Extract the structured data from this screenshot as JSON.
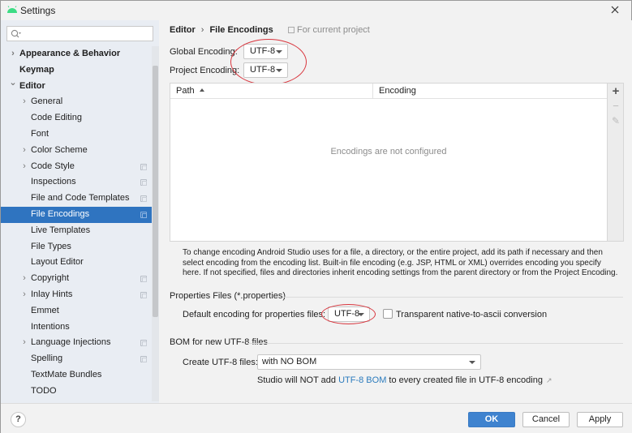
{
  "window": {
    "title": "Settings",
    "close_icon": "close-icon",
    "logo_icon": "android-icon"
  },
  "sidebar": {
    "search": {
      "value": "",
      "placeholder": "",
      "icon": "search-icon"
    },
    "items": [
      {
        "label": "Appearance & Behavior",
        "level": 0,
        "bold": true,
        "chevron": "right",
        "project_icon": false
      },
      {
        "label": "Keymap",
        "level": 0,
        "bold": true,
        "chevron": "none",
        "project_icon": false
      },
      {
        "label": "Editor",
        "level": 0,
        "bold": true,
        "chevron": "down",
        "project_icon": false
      },
      {
        "label": "General",
        "level": 1,
        "bold": false,
        "chevron": "right",
        "project_icon": false
      },
      {
        "label": "Code Editing",
        "level": 1,
        "bold": false,
        "chevron": "none",
        "project_icon": false
      },
      {
        "label": "Font",
        "level": 1,
        "bold": false,
        "chevron": "none",
        "project_icon": false
      },
      {
        "label": "Color Scheme",
        "level": 1,
        "bold": false,
        "chevron": "right",
        "project_icon": false
      },
      {
        "label": "Code Style",
        "level": 1,
        "bold": false,
        "chevron": "right",
        "project_icon": true
      },
      {
        "label": "Inspections",
        "level": 1,
        "bold": false,
        "chevron": "none",
        "project_icon": true
      },
      {
        "label": "File and Code Templates",
        "level": 1,
        "bold": false,
        "chevron": "none",
        "project_icon": true
      },
      {
        "label": "File Encodings",
        "level": 1,
        "bold": false,
        "chevron": "none",
        "project_icon": true,
        "selected": true
      },
      {
        "label": "Live Templates",
        "level": 1,
        "bold": false,
        "chevron": "none",
        "project_icon": false
      },
      {
        "label": "File Types",
        "level": 1,
        "bold": false,
        "chevron": "none",
        "project_icon": false
      },
      {
        "label": "Layout Editor",
        "level": 1,
        "bold": false,
        "chevron": "none",
        "project_icon": false
      },
      {
        "label": "Copyright",
        "level": 1,
        "bold": false,
        "chevron": "right",
        "project_icon": true
      },
      {
        "label": "Inlay Hints",
        "level": 1,
        "bold": false,
        "chevron": "right",
        "project_icon": true
      },
      {
        "label": "Emmet",
        "level": 1,
        "bold": false,
        "chevron": "none",
        "project_icon": false
      },
      {
        "label": "Intentions",
        "level": 1,
        "bold": false,
        "chevron": "none",
        "project_icon": false
      },
      {
        "label": "Language Injections",
        "level": 1,
        "bold": false,
        "chevron": "right",
        "project_icon": true
      },
      {
        "label": "Spelling",
        "level": 1,
        "bold": false,
        "chevron": "none",
        "project_icon": true
      },
      {
        "label": "TextMate Bundles",
        "level": 1,
        "bold": false,
        "chevron": "none",
        "project_icon": false
      },
      {
        "label": "TODO",
        "level": 1,
        "bold": false,
        "chevron": "none",
        "project_icon": false
      }
    ]
  },
  "main": {
    "breadcrumb": {
      "parent": "Editor",
      "separator": "›",
      "current": "File Encodings"
    },
    "scope_note": "For current project",
    "global_encoding": {
      "label": "Global Encoding:",
      "value": "UTF-8"
    },
    "project_encoding": {
      "label": "Project Encoding:",
      "value": "UTF-8"
    },
    "table": {
      "columns": [
        "Path",
        "Encoding"
      ],
      "sort_column": "Path",
      "sort_direction": "ascending",
      "rows": [],
      "empty_text": "Encodings are not configured",
      "toolbar": {
        "add": "+",
        "remove": "−",
        "edit": "✎"
      }
    },
    "help_text": "To change encoding Android Studio uses for a file, a directory, or the entire project, add its path if necessary and then select encoding from the encoding list. Built-in file encoding (e.g. JSP, HTML or XML) overrides encoding you specify here. If not specified, files and directories inherit encoding settings from the parent directory or from the Project Encoding.",
    "properties": {
      "group_title": "Properties Files (*.properties)",
      "default_label": "Default encoding for properties files:",
      "default_value": "UTF-8",
      "transparent_label": "Transparent native-to-ascii conversion",
      "transparent_checked": false
    },
    "bom": {
      "group_title": "BOM for new UTF-8 files",
      "create_label": "Create UTF-8 files:",
      "create_value": "with NO BOM",
      "note_prefix": "Studio will NOT add ",
      "note_link": "UTF-8 BOM",
      "note_suffix": " to every created file in UTF-8 encoding",
      "note_ext_icon": "↗"
    }
  },
  "footer": {
    "help_label": "?",
    "ok_label": "OK",
    "cancel_label": "Cancel",
    "apply_label": "Apply"
  },
  "colors": {
    "selection": "#2f74c0",
    "primary_button": "#3f83cf",
    "link": "#2b7bbd",
    "annotation": "#d9363e",
    "android_green": "#3ddc84"
  }
}
